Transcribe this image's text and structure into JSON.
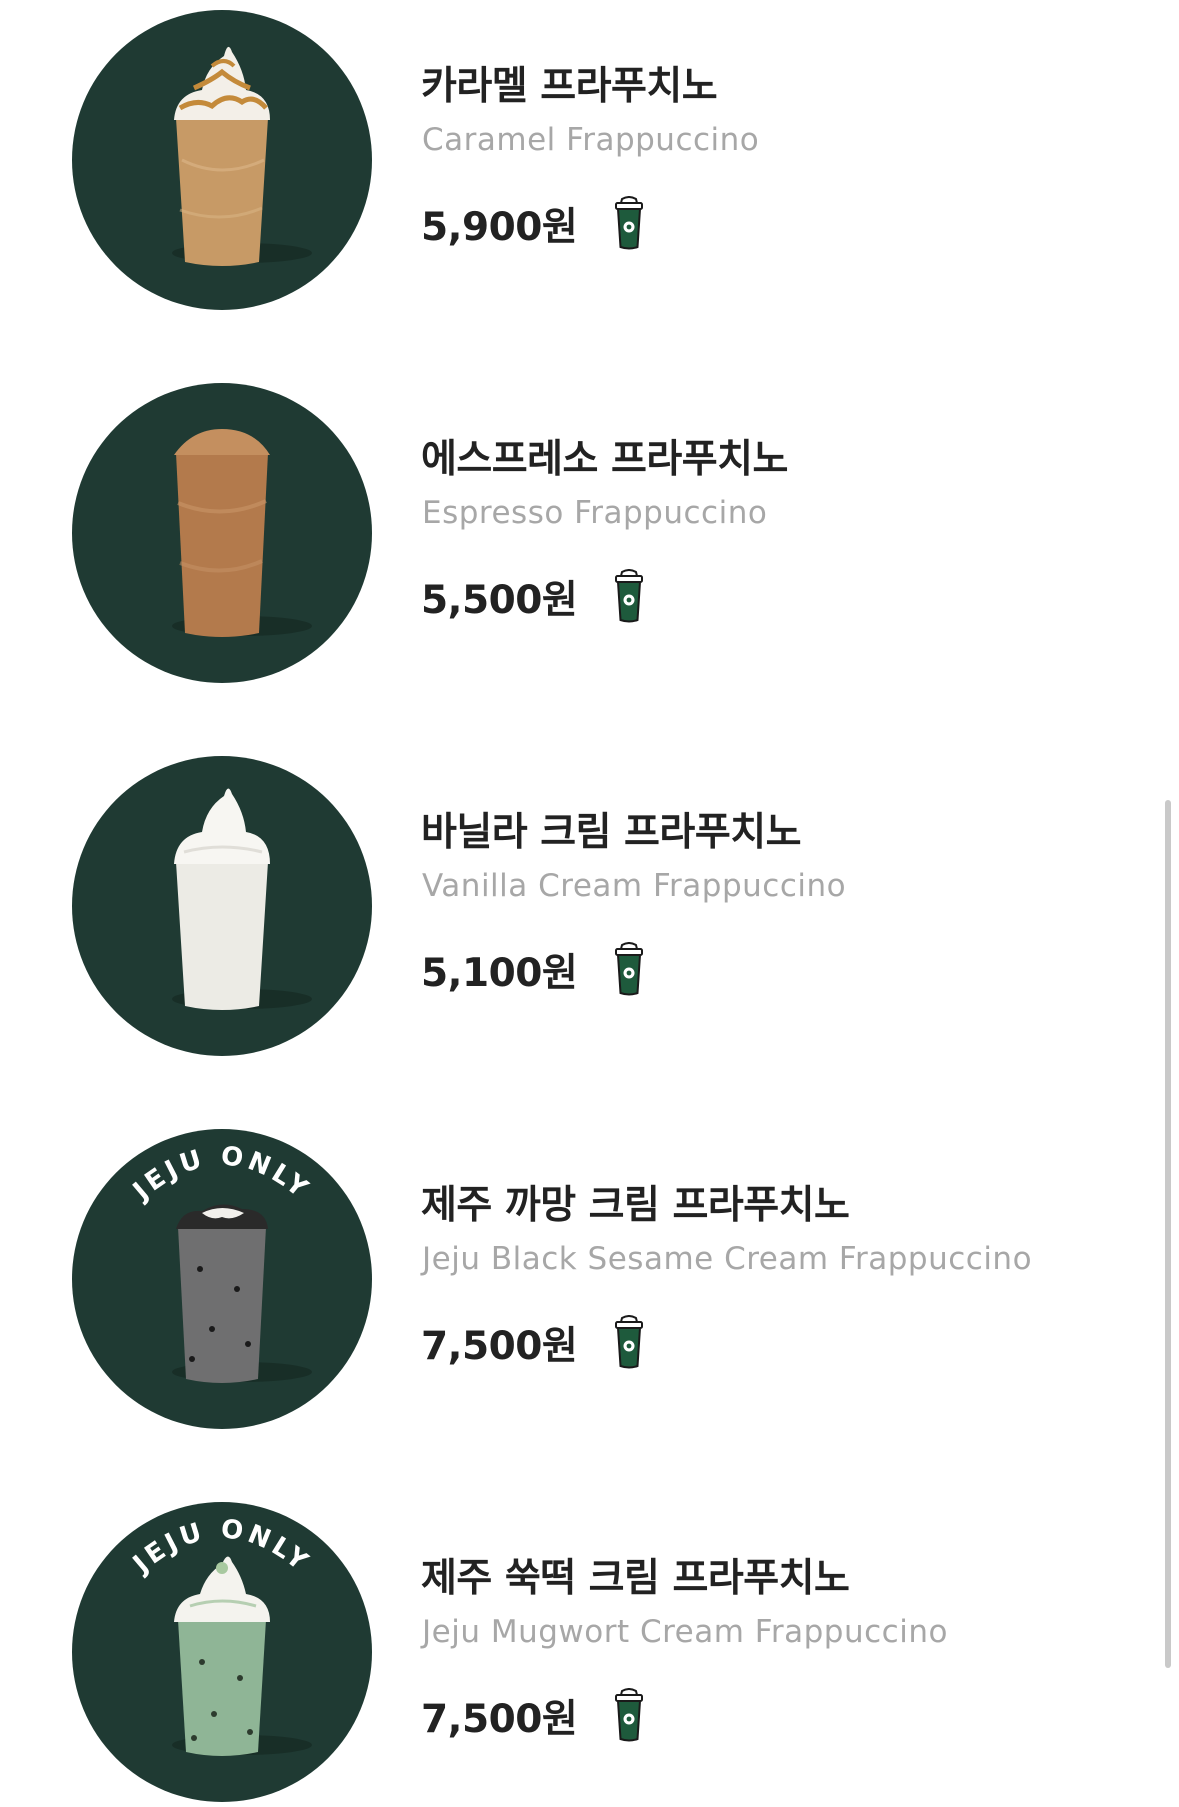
{
  "menu": {
    "items": [
      {
        "name_ko": "카라멜 프라푸치노",
        "name_en": "Caramel Frappuccino",
        "price": "5,900원",
        "image": "caramel-frappuccino-image",
        "badge_icon": "frappuccino-cup-icon"
      },
      {
        "name_ko": "에스프레소 프라푸치노",
        "name_en": "Espresso Frappuccino",
        "price": "5,500원",
        "image": "espresso-frappuccino-image",
        "badge_icon": "frappuccino-cup-icon"
      },
      {
        "name_ko": "바닐라 크림 프라푸치노",
        "name_en": "Vanilla Cream Frappuccino",
        "price": "5,100원",
        "image": "vanilla-cream-frappuccino-image",
        "badge_icon": "frappuccino-cup-icon"
      },
      {
        "name_ko": "제주 까망 크림 프라푸치노",
        "name_en": "Jeju Black Sesame Cream Frappuccino",
        "price": "7,500원",
        "image": "jeju-black-sesame-frappuccino-image",
        "image_label": "JEJU ONLY",
        "badge_icon": "frappuccino-cup-icon"
      },
      {
        "name_ko": "제주 쑥떡 크림 프라푸치노",
        "name_en": "Jeju Mugwort Cream Frappuccino",
        "price": "7,500원",
        "image": "jeju-mugwort-frappuccino-image",
        "image_label": "JEJU ONLY",
        "badge_icon": "frappuccino-cup-icon"
      }
    ]
  },
  "colors": {
    "thumb_bg": "#1f3a33",
    "title_text": "#222222",
    "subtitle_text": "#a7a7a7",
    "cup_green": "#1e5a3c"
  }
}
